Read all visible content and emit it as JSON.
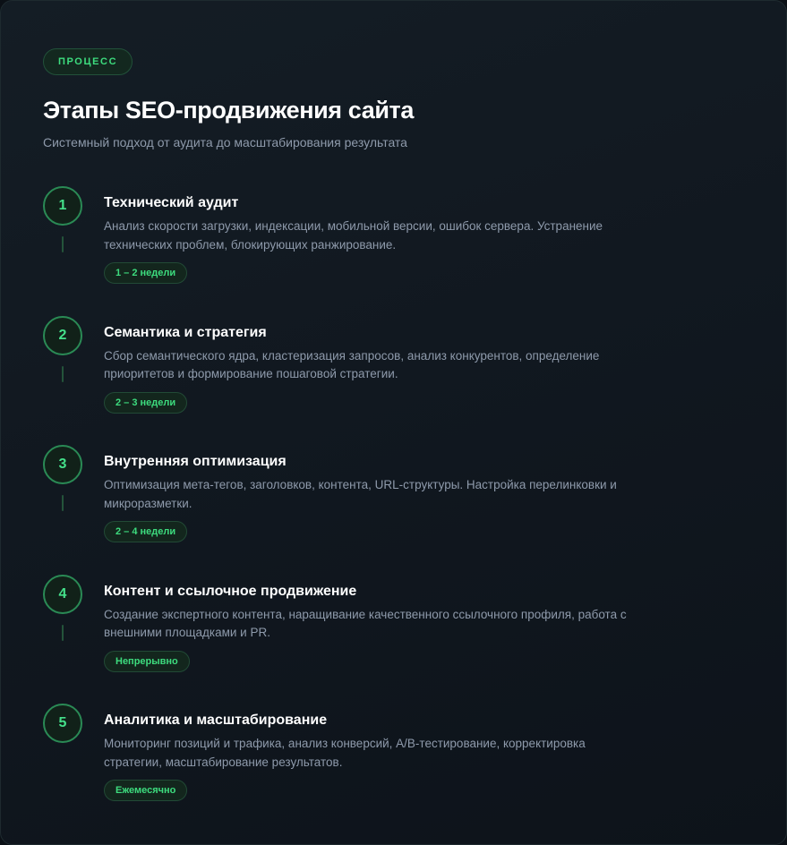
{
  "header": {
    "tag": "ПРОЦЕСС",
    "title": "Этапы SEO-продвижения сайта",
    "subtitle": "Системный подход от аудита до масштабирования результата"
  },
  "steps": [
    {
      "number": "1",
      "title": "Технический аудит",
      "description": "Анализ скорости загрузки, индексации, мобильной версии, ошибок сервера. Устранение технических проблем, блокирующих ранжирование.",
      "duration": "1 – 2 недели"
    },
    {
      "number": "2",
      "title": "Семантика и стратегия",
      "description": "Сбор семантического ядра, кластеризация запросов, анализ конкурентов, определение приоритетов и формирование пошаговой стратегии.",
      "duration": "2 – 3 недели"
    },
    {
      "number": "3",
      "title": "Внутренняя оптимизация",
      "description": "Оптимизация мета-тегов, заголовков, контента, URL-структуры. Настройка перелинковки и микроразметки.",
      "duration": "2 – 4 недели"
    },
    {
      "number": "4",
      "title": "Контент и ссылочное продвижение",
      "description": "Создание экспертного контента, наращивание качественного ссылочного профиля, работа с внешними площадками и PR.",
      "duration": "Непрерывно"
    },
    {
      "number": "5",
      "title": "Аналитика и масштабирование",
      "description": "Мониторинг позиций и трафика, анализ конверсий, A/B-тестирование, корректировка стратегии, масштабирование результатов.",
      "duration": "Ежемесячно"
    }
  ],
  "colors": {
    "accent": "#3ddc7e",
    "background": "#111820",
    "text_primary": "#ffffff",
    "text_secondary": "#8e9aab"
  }
}
